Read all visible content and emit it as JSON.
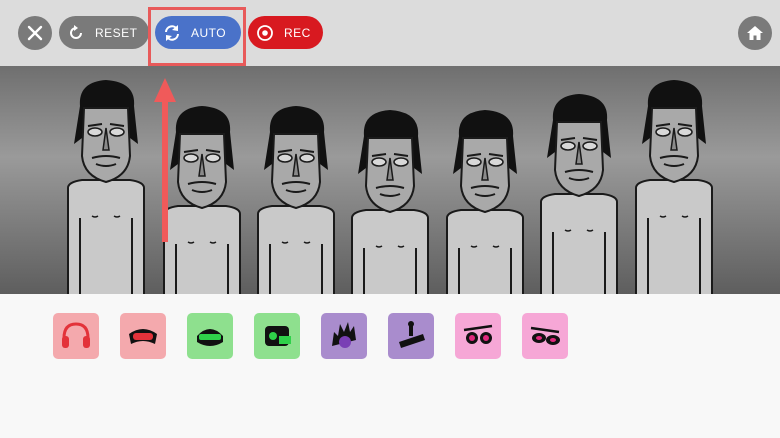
{
  "toolbar": {
    "close_icon": "close-icon",
    "reset_label": "RESET",
    "auto_label": "AUTO",
    "rec_label": "REC",
    "home_icon": "home-icon"
  },
  "colors": {
    "toolbar_bg": "#dcdcdc",
    "reset_bg": "#7a7a7a",
    "auto_bg": "#4a72c9",
    "rec_bg": "#d81920",
    "highlight": "#e85a5a",
    "beats": "#f4a9ad",
    "effects": "#8ee08e",
    "melodies": "#a98ccd",
    "voices": "#f6a7d6"
  },
  "stage": {
    "characters": 7
  },
  "sounds": [
    {
      "icon": "headphones-icon",
      "group": "beats"
    },
    {
      "icon": "goggles-icon",
      "group": "beats"
    },
    {
      "icon": "visor-icon",
      "group": "effects"
    },
    {
      "icon": "speaker-icon",
      "group": "effects"
    },
    {
      "icon": "spiky-hair-icon",
      "group": "melodies"
    },
    {
      "icon": "cap-icon",
      "group": "melodies"
    },
    {
      "icon": "sunglasses-icon",
      "group": "voices"
    },
    {
      "icon": "round-glasses-icon",
      "group": "voices"
    }
  ]
}
